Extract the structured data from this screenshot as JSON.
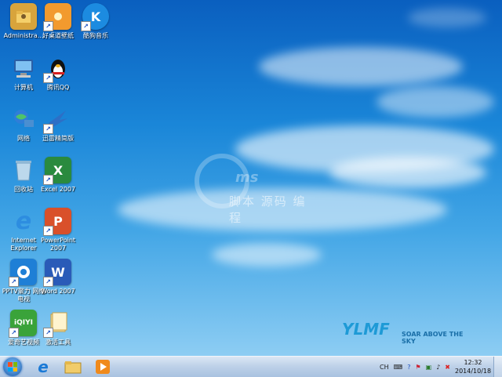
{
  "desktop": {
    "icons": [
      {
        "id": "administrator",
        "label": "Administra...",
        "glyph": "folder-user-icon",
        "color": "#d8a43c",
        "shortcut": false
      },
      {
        "id": "wallpaper",
        "label": "好桌道壁纸",
        "glyph": "sun-icon",
        "color": "#f29a2e",
        "shortcut": true
      },
      {
        "id": "kugou",
        "label": "酷狗音乐",
        "glyph": "K",
        "color": "#1c8be0",
        "shortcut": true
      },
      {
        "id": "computer",
        "label": "计算机",
        "glyph": "computer-icon",
        "color": "#4a8fd1",
        "shortcut": false
      },
      {
        "id": "qq",
        "label": "腾讯QQ",
        "glyph": "penguin-icon",
        "color": "#1a1a1a",
        "shortcut": true
      },
      {
        "id": "network",
        "label": "网络",
        "glyph": "network-icon",
        "color": "#2f7ed8",
        "shortcut": false
      },
      {
        "id": "xunlei",
        "label": "迅雷精简版",
        "glyph": "bird-icon",
        "color": "#2d6fc6",
        "shortcut": true
      },
      {
        "id": "recycle",
        "label": "回收站",
        "glyph": "bin-icon",
        "color": "#8fb8d6",
        "shortcut": false
      },
      {
        "id": "excel",
        "label": "Excel 2007",
        "glyph": "X",
        "color": "#2a8a3e",
        "shortcut": true
      },
      {
        "id": "ie",
        "label": "Internet Explorer",
        "glyph": "e",
        "color": "#2d8de0",
        "shortcut": false
      },
      {
        "id": "powerpoint",
        "label": "PowerPoint 2007",
        "glyph": "P",
        "color": "#d9502a",
        "shortcut": true
      },
      {
        "id": "pptv",
        "label": "PPTV聚力 网络电视",
        "glyph": "pptv-icon",
        "color": "#1e7fd6",
        "shortcut": true
      },
      {
        "id": "word",
        "label": "Word 2007",
        "glyph": "W",
        "color": "#2a5bb8",
        "shortcut": true
      },
      {
        "id": "iqiyi",
        "label": "爱奇艺视频",
        "glyph": "iQIYI",
        "color": "#3aa33a",
        "shortcut": true
      },
      {
        "id": "brochure",
        "label": "激活工具",
        "glyph": "folder-icon",
        "color": "#e1b755",
        "shortcut": true
      }
    ]
  },
  "watermark": {
    "text": "脚本 源码 编程",
    "brand": "ms"
  },
  "branding": {
    "logo": "YLMF",
    "tagline": "SOAR ABOVE THE SKY"
  },
  "taskbar": {
    "pinned": [
      {
        "id": "ie",
        "icon": "ie-icon"
      },
      {
        "id": "explorer",
        "icon": "folder-icon"
      },
      {
        "id": "media",
        "icon": "media-player-icon"
      }
    ],
    "tray": {
      "lang": "CH",
      "icons": [
        "keyboard-icon",
        "help-icon",
        "flag-icon",
        "network-icon",
        "volume-icon",
        "security-icon"
      ]
    },
    "clock": {
      "time": "12:32",
      "date": "2014/10/18"
    }
  }
}
